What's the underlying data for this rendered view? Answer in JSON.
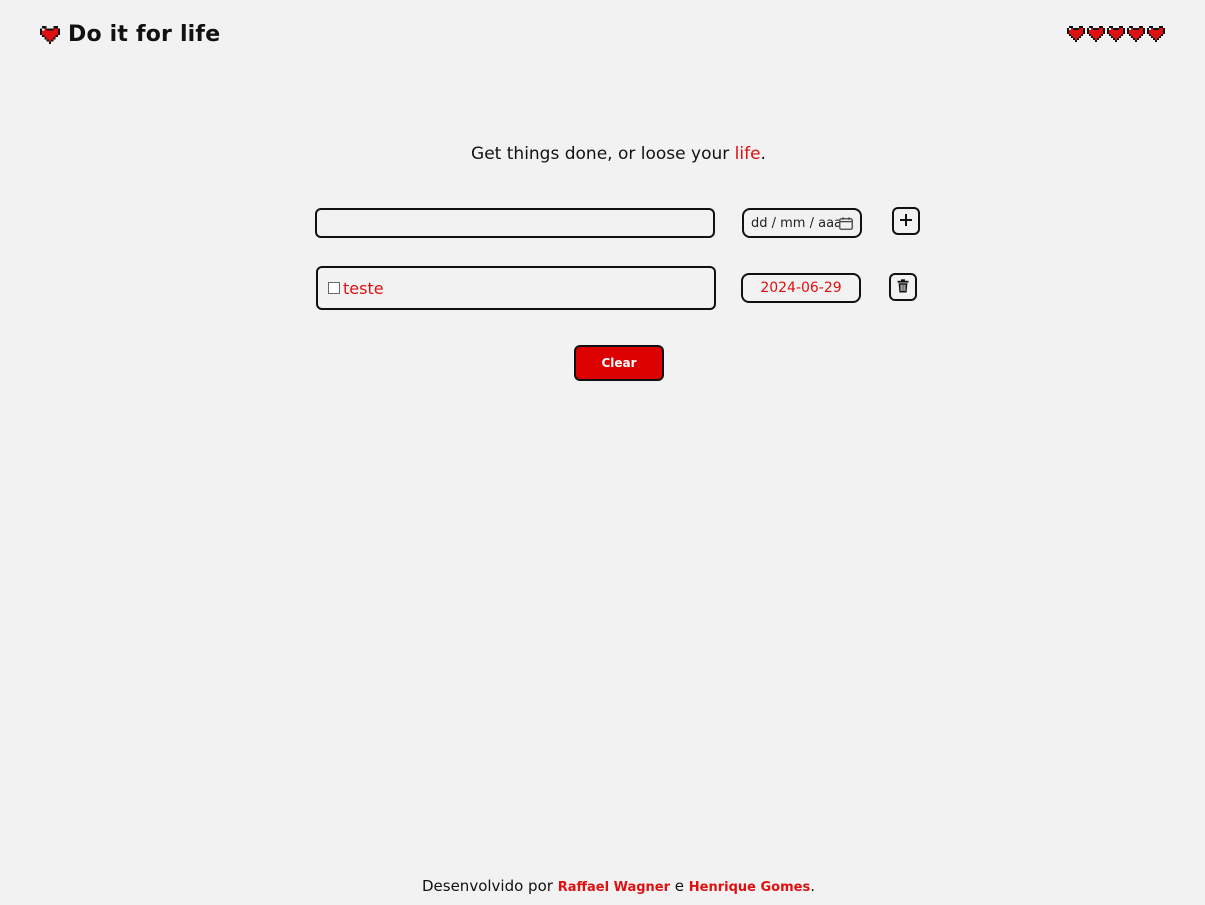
{
  "brand": {
    "title": "Do it for life",
    "icon": "heart-icon"
  },
  "lives": {
    "count": 5,
    "icon": "heart-icon"
  },
  "tagline": {
    "prefix": "Get things done, or loose your ",
    "accent": "life",
    "suffix": "."
  },
  "new_task": {
    "text_value": "",
    "date_placeholder": "dd / mm / aaaa",
    "add_icon": "plus-icon"
  },
  "tasks": [
    {
      "label": "teste",
      "checked": false,
      "date": "2024-06-29",
      "delete_icon": "trash-icon"
    }
  ],
  "clear_label": "Clear",
  "footer": {
    "prefix": "Desenvolvido por ",
    "author1": "Raffael Wagner",
    "middle": " e ",
    "author2": "Henrique Gomes",
    "suffix": "."
  },
  "colors": {
    "accent": "#e01010",
    "button_red": "#dd0000",
    "background": "#f2f2f2"
  }
}
